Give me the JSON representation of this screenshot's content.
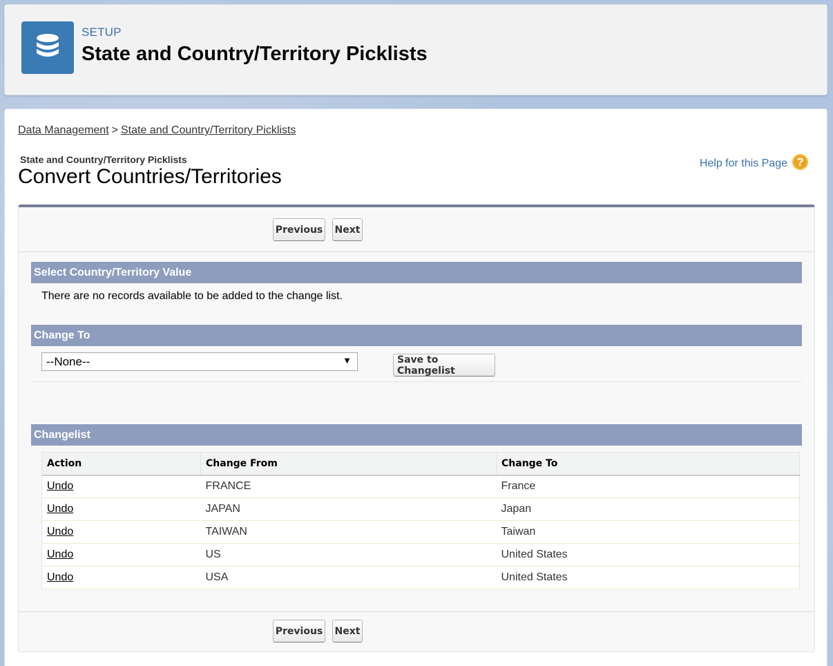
{
  "header": {
    "eyebrow": "SETUP",
    "title": "State and Country/Territory Picklists",
    "icon": "database-icon"
  },
  "breadcrumb": {
    "items": [
      "Data Management",
      "State and Country/Territory Picklists"
    ],
    "separator": ">"
  },
  "page": {
    "subtitle": "State and Country/Territory Picklists",
    "title": "Convert Countries/Territories",
    "help_label": "Help for this Page",
    "help_icon": "question-icon"
  },
  "buttons": {
    "previous": "Previous",
    "next": "Next",
    "save_changelist": "Save to Changelist"
  },
  "sections": {
    "select_value": "Select Country/Territory Value",
    "no_records": "There are no records available to be added to the change list.",
    "change_to": "Change To",
    "changelist": "Changelist"
  },
  "change_to_select": {
    "value": "--None--"
  },
  "table": {
    "headers": [
      "Action",
      "Change From",
      "Change To"
    ],
    "rows": [
      {
        "action": "Undo",
        "from": "FRANCE",
        "to": "France"
      },
      {
        "action": "Undo",
        "from": "JAPAN",
        "to": "Japan"
      },
      {
        "action": "Undo",
        "from": "TAIWAN",
        "to": "Taiwan"
      },
      {
        "action": "Undo",
        "from": "US",
        "to": "United States"
      },
      {
        "action": "Undo",
        "from": "USA",
        "to": "United States"
      }
    ]
  },
  "colors": {
    "section_header": "#8e9dbe",
    "block_top_border": "#737e96",
    "header_icon_bg": "#3a7ab5",
    "link_blue": "#3a6fb0",
    "help_icon": "#e9a422"
  }
}
